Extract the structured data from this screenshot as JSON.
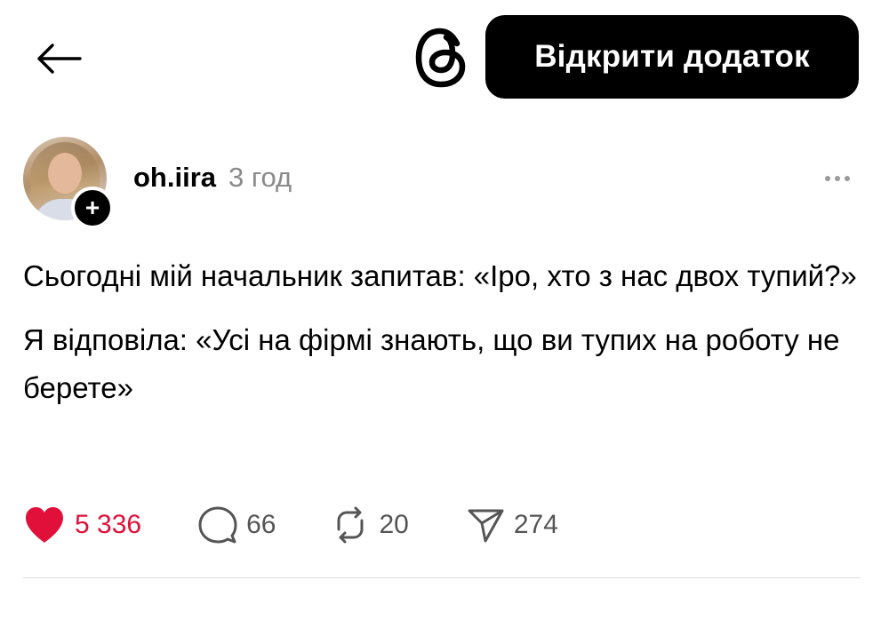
{
  "header": {
    "open_app_label": "Відкрити додаток",
    "back_icon": "arrow-left-icon",
    "logo_icon": "threads-logo-icon"
  },
  "post": {
    "username": "oh.iira",
    "time_ago": "3 год",
    "follow_badge_symbol": "+",
    "paragraphs": [
      "Сьогодні мій начальник запитав: «Іро, хто з нас двох тупий?»",
      "Я відповіла: «Усі на фірмі знають, що ви тупих на роботу не берете»"
    ],
    "stats": {
      "likes": "5 336",
      "replies": "66",
      "reposts": "20",
      "shares": "274"
    },
    "liked": true
  },
  "colors": {
    "like": "#e0103a",
    "button_bg": "#000000",
    "muted_text": "#8a8a8a"
  }
}
